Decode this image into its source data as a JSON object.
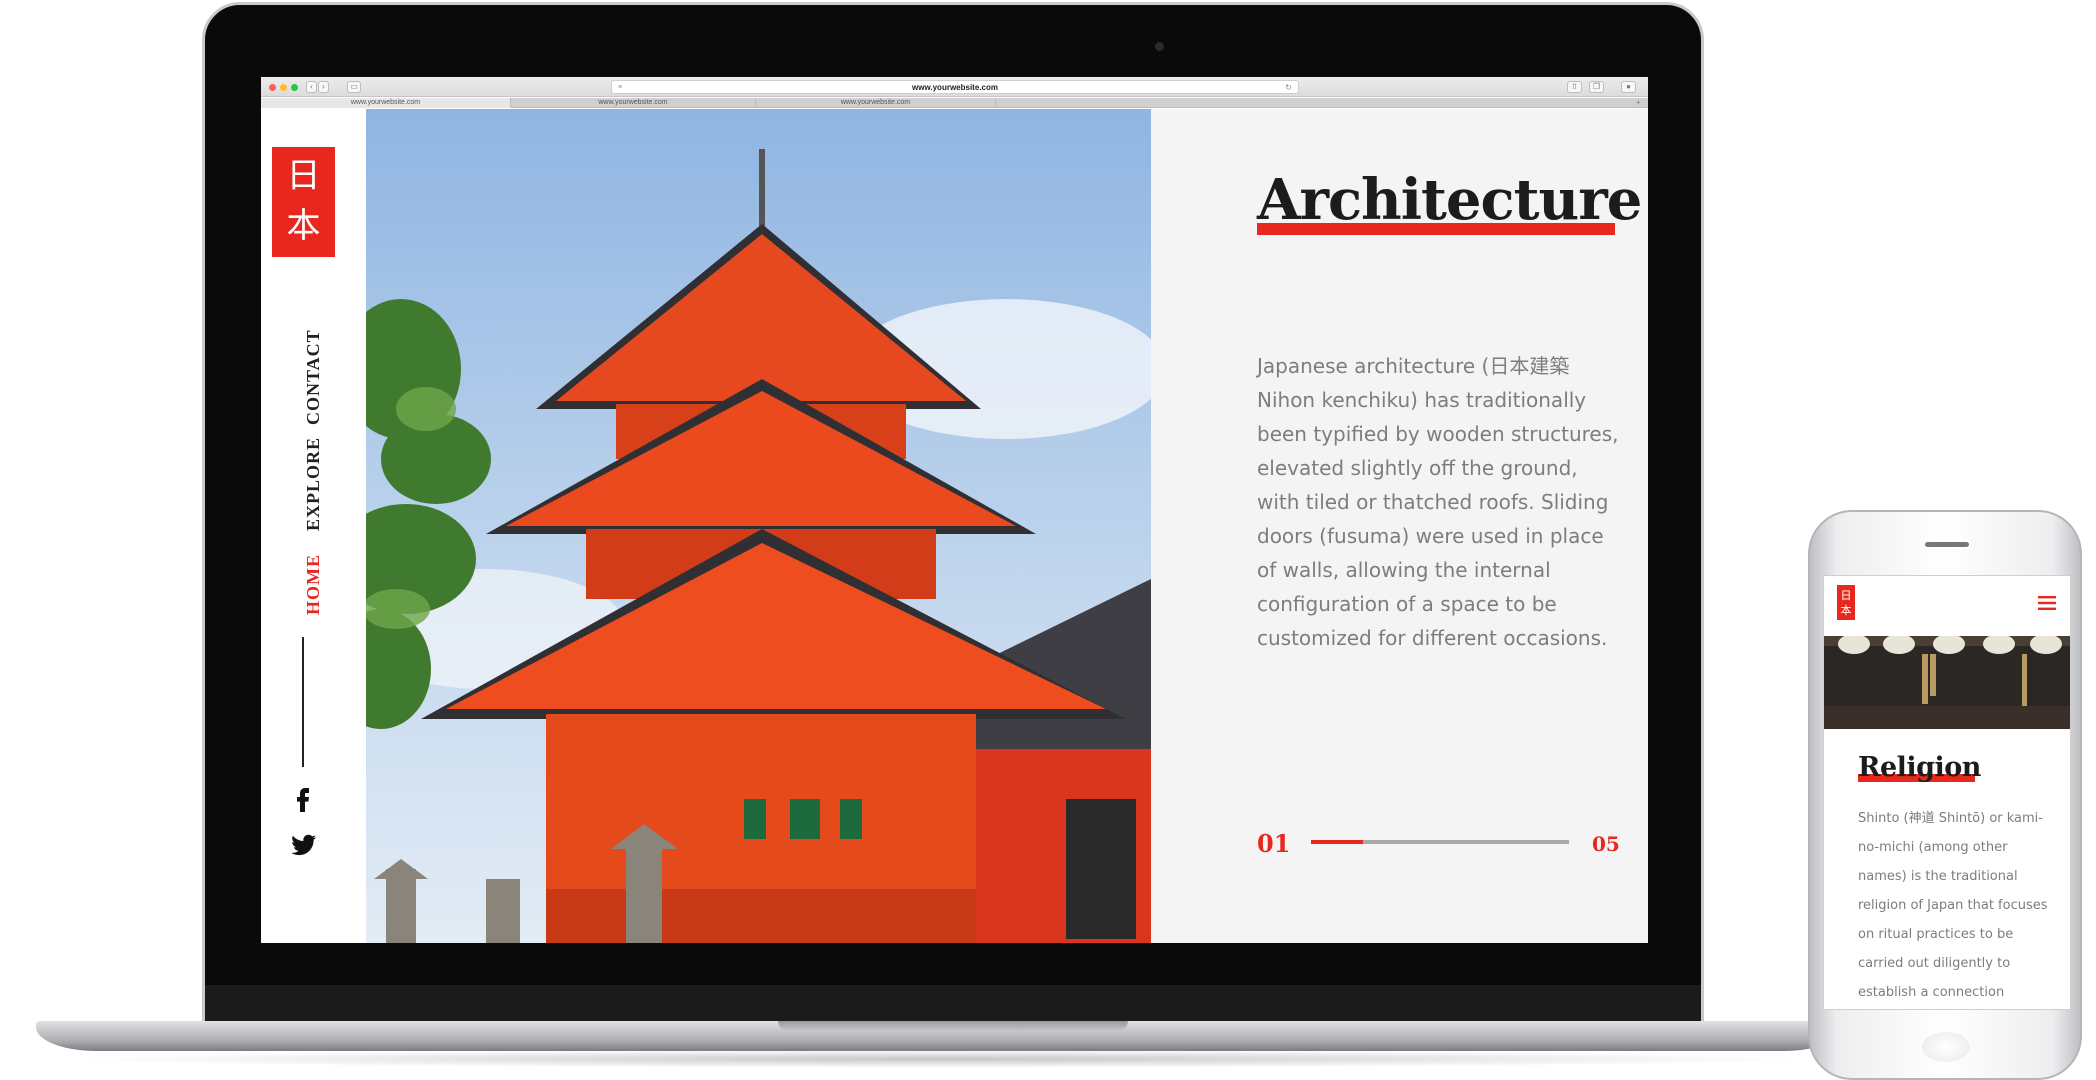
{
  "browser": {
    "url": "www.yourwebsite.com",
    "tabs": [
      {
        "label": "www.yourwebsite.com"
      },
      {
        "label": "www.yourwebsite.com"
      },
      {
        "label": "www.yourwebsite.com"
      }
    ],
    "tab_close_glyph": "×",
    "new_tab_glyph": "+"
  },
  "site": {
    "logo_chars": [
      "日",
      "本"
    ],
    "nav": [
      {
        "label": "CONTACT",
        "active": false
      },
      {
        "label": "EXPLORE",
        "active": false
      },
      {
        "label": "HOME",
        "active": true
      }
    ],
    "social_icons": [
      "facebook-icon",
      "twitter-icon"
    ]
  },
  "main": {
    "title": "Architecture",
    "body": "Japanese architecture (日本建築 Nihon kenchiku) has traditionally been typified by wooden structures, elevated slightly off the ground, with tiled or thatched roofs. Sliding doors (fusuma) were used in place of walls, allowing the internal configuration of a space to be customized for different occasions.",
    "pager": {
      "current": "01",
      "total": "05",
      "progress": 0.2
    }
  },
  "mobile": {
    "logo_chars": [
      "日",
      "本"
    ],
    "title": "Religion",
    "body": "Shinto (神道 Shintō) or kami-no-michi (among other names) is the traditional religion of Japan that focuses on ritual practices to be carried out diligently to establish a connection"
  },
  "colors": {
    "accent": "#e8281f",
    "ink": "#1c1c1c",
    "muted": "#7d7d7d",
    "panel": "#f4f4f4"
  }
}
